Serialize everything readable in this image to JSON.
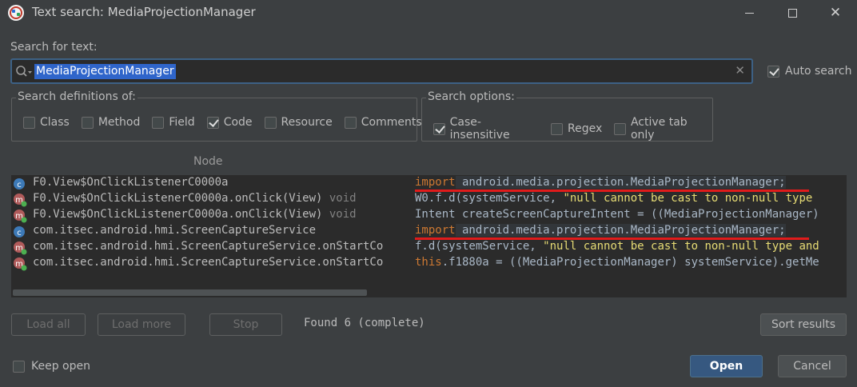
{
  "window": {
    "title": "Text search: MediaProjectionManager",
    "minimize": "—",
    "maximize": "☐",
    "close": "✕"
  },
  "search": {
    "label": "Search for text:",
    "value": "MediaProjectionManager",
    "auto_search_label": "Auto search",
    "auto_search_checked": true
  },
  "definitions": {
    "title": "Search definitions of:",
    "options": [
      {
        "label": "Class",
        "checked": false
      },
      {
        "label": "Method",
        "checked": false
      },
      {
        "label": "Field",
        "checked": false
      },
      {
        "label": "Code",
        "checked": true
      },
      {
        "label": "Resource",
        "checked": false
      },
      {
        "label": "Comments",
        "checked": false
      }
    ]
  },
  "options": {
    "title": "Search options:",
    "items": [
      {
        "label": "Case-insensitive",
        "checked": true
      },
      {
        "label": "Regex",
        "checked": false
      },
      {
        "label": "Active tab only",
        "checked": false
      }
    ]
  },
  "results": {
    "column_node": "Node",
    "rows": [
      {
        "icon": "class-icon",
        "node": "F0.View$OnClickListenerC0000a",
        "suffix": "",
        "code_keyword": "import",
        "code_rest": " android.media.projection.MediaProjectionManager;"
      },
      {
        "icon": "method-icon",
        "node": "F0.View$OnClickListenerC0000a.onClick(View)",
        "suffix": " void",
        "code_keyword": "",
        "code_rest": "W0.f.d(systemService, ",
        "code_string": "\"null cannot be cast to non-null type"
      },
      {
        "icon": "method-icon",
        "node": "F0.View$OnClickListenerC0000a.onClick(View)",
        "suffix": " void",
        "code_keyword": "",
        "code_rest": "Intent createScreenCaptureIntent = ((MediaProjectionManager)"
      },
      {
        "icon": "class-icon",
        "node": "com.itsec.android.hmi.ScreenCaptureService",
        "suffix": "",
        "code_keyword": "import",
        "code_rest": " android.media.projection.MediaProjectionManager;"
      },
      {
        "icon": "method-icon",
        "node": "com.itsec.android.hmi.ScreenCaptureService.onStartCo",
        "suffix": "",
        "code_keyword": "",
        "code_rest": "f.d(systemService, ",
        "code_string": "\"null cannot be cast to non-null type and"
      },
      {
        "icon": "method-icon",
        "node": "com.itsec.android.hmi.ScreenCaptureService.onStartCo",
        "suffix": "",
        "code_keyword": "this",
        "code_rest": ".f1880a = ((MediaProjectionManager) systemService).getMe"
      }
    ]
  },
  "buttons": {
    "load_all": "Load all",
    "load_more": "Load more",
    "stop": "Stop",
    "sort_results": "Sort results",
    "open": "Open",
    "cancel": "Cancel"
  },
  "status": {
    "found": "Found 6 (complete)"
  },
  "keep_open": {
    "label": "Keep open",
    "checked": false
  },
  "colors": {
    "background": "#3c3f41",
    "panel": "#2b2b2b",
    "accent": "#365880",
    "selection": "#2f65ca",
    "keyword": "#cc7832",
    "string": "#e6db74",
    "underline": "#e01b1b"
  }
}
